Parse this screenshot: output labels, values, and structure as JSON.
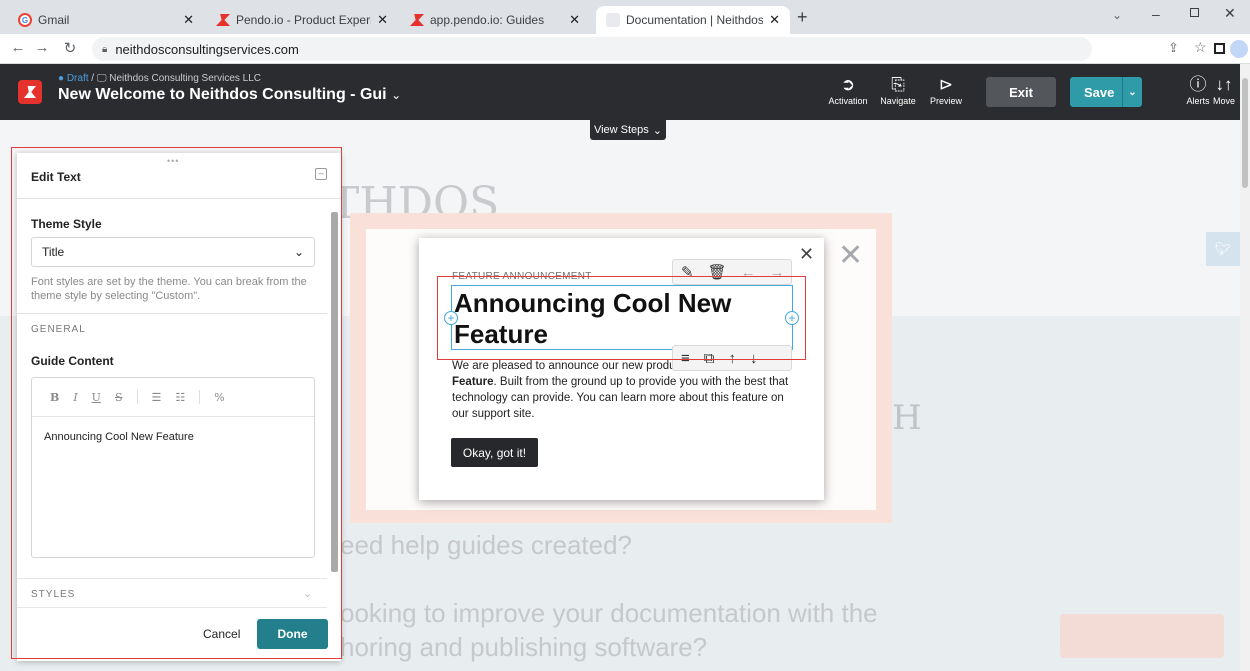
{
  "browser": {
    "tabs": [
      {
        "title": "Gmail",
        "active": false
      },
      {
        "title": "Pendo.io - Product Experience an",
        "active": false
      },
      {
        "title": "app.pendo.io: Guides",
        "active": false
      },
      {
        "title": "Documentation | Neithdos Consu",
        "active": true
      }
    ],
    "new_tab": "+",
    "url": "neithdosconsultingservices.com"
  },
  "pendo": {
    "draft": "Draft",
    "account": "Neithdos Consulting Services LLC",
    "guide_name": "New Welcome to Neithdos Consulting - Gui",
    "tools": {
      "activation": "Activation",
      "navigate": "Navigate",
      "preview": "Preview",
      "alerts": "Alerts",
      "move": "Move"
    },
    "exit": "Exit",
    "save": "Save",
    "view_steps": "View Steps"
  },
  "page_bg": {
    "heading_fragment": "THDOS",
    "line1": "eed help guides created?",
    "line2": "ooking to improve your documentation with the",
    "line3": "horing and publishing software?"
  },
  "guide": {
    "eyebrow": "FEATURE ANNOUNCEMENT",
    "title": "Announcing Cool New Feature",
    "body_pre": "We are pleased to announce our new produ",
    "body_bold": "Feature",
    "body_post": ". Built from the ground up to provide you with the best that technology can provide. You can learn more about this feature on our support site.",
    "button": "Okay, got it!"
  },
  "panel": {
    "title": "Edit Text",
    "theme_style_label": "Theme Style",
    "theme_style_value": "Title",
    "theme_help": "Font styles are set by the theme. You can break from the theme style by selecting \"Custom\".",
    "general": "GENERAL",
    "guide_content_label": "Guide Content",
    "editor_text": "Announcing Cool New Feature",
    "styles": "STYLES",
    "cancel": "Cancel",
    "done": "Done"
  },
  "colors": {
    "accent": "#2f9aa8",
    "highlight": "#e03c3c",
    "selection": "#3fa9e0",
    "pendo_red": "#e5322d"
  }
}
